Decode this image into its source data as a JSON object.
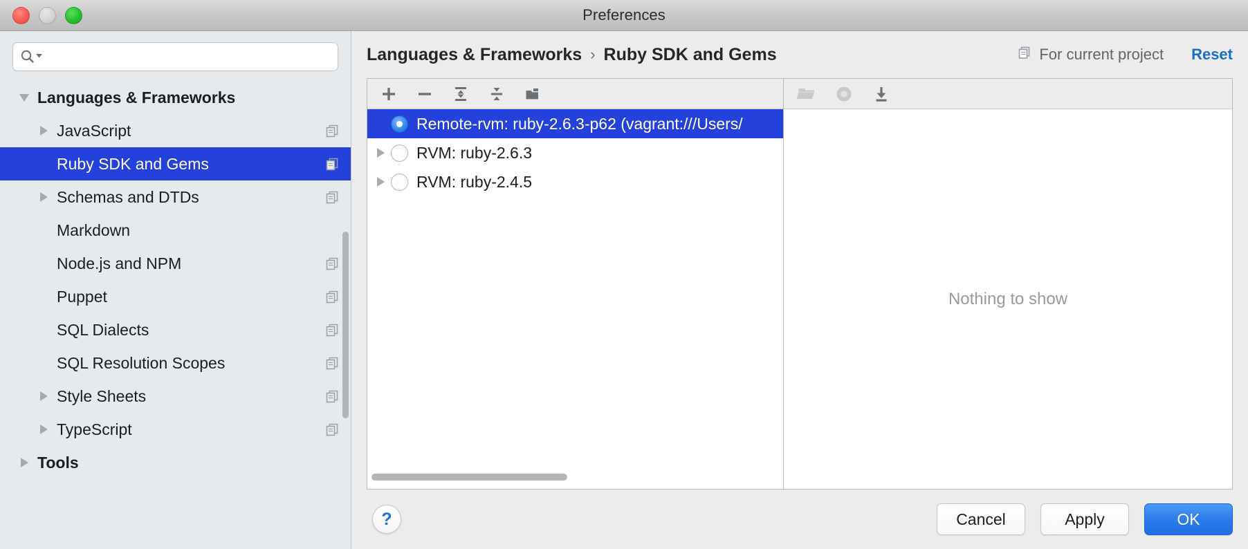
{
  "window": {
    "title": "Preferences",
    "traffic_lights": [
      "close-button",
      "minimize-button",
      "zoom-button"
    ]
  },
  "search": {
    "value": "",
    "placeholder": "",
    "icon": "search-icon"
  },
  "sidebar": {
    "items": [
      {
        "label": "Languages & Frameworks",
        "level": 0,
        "twisty": "down",
        "selected": false,
        "project_icon": false
      },
      {
        "label": "JavaScript",
        "level": 1,
        "twisty": "right",
        "selected": false,
        "project_icon": true
      },
      {
        "label": "Ruby SDK and Gems",
        "level": 1,
        "twisty": "none",
        "selected": true,
        "project_icon": true
      },
      {
        "label": "Schemas and DTDs",
        "level": 1,
        "twisty": "right",
        "selected": false,
        "project_icon": true
      },
      {
        "label": "Markdown",
        "level": 1,
        "twisty": "none",
        "selected": false,
        "project_icon": false
      },
      {
        "label": "Node.js and NPM",
        "level": 1,
        "twisty": "none",
        "selected": false,
        "project_icon": true
      },
      {
        "label": "Puppet",
        "level": 1,
        "twisty": "none",
        "selected": false,
        "project_icon": true
      },
      {
        "label": "SQL Dialects",
        "level": 1,
        "twisty": "none",
        "selected": false,
        "project_icon": true
      },
      {
        "label": "SQL Resolution Scopes",
        "level": 1,
        "twisty": "none",
        "selected": false,
        "project_icon": true
      },
      {
        "label": "Style Sheets",
        "level": 1,
        "twisty": "right",
        "selected": false,
        "project_icon": true
      },
      {
        "label": "TypeScript",
        "level": 1,
        "twisty": "right",
        "selected": false,
        "project_icon": true
      },
      {
        "label": "Tools",
        "level": 0,
        "twisty": "right",
        "selected": false,
        "project_icon": false
      }
    ]
  },
  "header": {
    "breadcrumb": [
      "Languages & Frameworks",
      "Ruby SDK and Gems"
    ],
    "separator": "›",
    "for_current_project": "For current project",
    "for_current_project_icon": "project-scope-icon",
    "reset_label": "Reset",
    "reset_color": "#1a6fc4"
  },
  "left_toolbar": {
    "buttons": [
      {
        "name": "add-sdk-button",
        "icon": "plus-icon",
        "enabled": true
      },
      {
        "name": "remove-sdk-button",
        "icon": "minus-icon",
        "enabled": true
      },
      {
        "name": "expand-all-button",
        "icon": "expand-all-icon",
        "enabled": true
      },
      {
        "name": "collapse-all-button",
        "icon": "collapse-all-icon",
        "enabled": true
      },
      {
        "name": "copy-sdk-button",
        "icon": "copy-folder-icon",
        "enabled": true
      }
    ]
  },
  "right_toolbar": {
    "buttons": [
      {
        "name": "open-folder-button",
        "icon": "folder-icon",
        "enabled": false
      },
      {
        "name": "gem-manager-button",
        "icon": "circle-icon",
        "enabled": false
      },
      {
        "name": "install-gem-button",
        "icon": "download-icon",
        "enabled": false
      }
    ]
  },
  "sdk_list": {
    "rows": [
      {
        "label": "Remote-rvm: ruby-2.6.3-p62 (vagrant:///Users/",
        "selected": true,
        "checked": true,
        "twisty": "none"
      },
      {
        "label": "RVM: ruby-2.6.3",
        "selected": false,
        "checked": false,
        "twisty": "right"
      },
      {
        "label": "RVM: ruby-2.4.5",
        "selected": false,
        "checked": false,
        "twisty": "right"
      }
    ],
    "selection_color": "#2441dc",
    "horizontal_scrollbar": true
  },
  "right_panel": {
    "empty_message": "Nothing to show"
  },
  "footer": {
    "help_label": "?",
    "buttons": [
      {
        "label": "Cancel",
        "name": "cancel-button",
        "style": "plain"
      },
      {
        "label": "Apply",
        "name": "apply-button",
        "style": "plain"
      },
      {
        "label": "OK",
        "name": "ok-button",
        "style": "primary"
      }
    ],
    "primary_color": "#2c7ced"
  }
}
